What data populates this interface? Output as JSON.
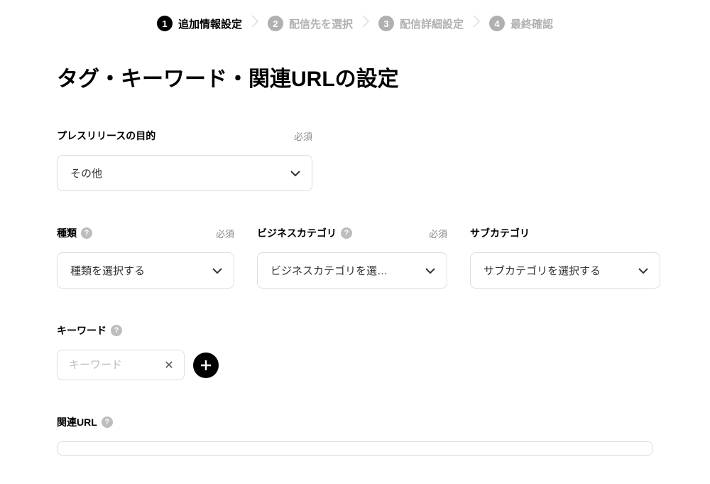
{
  "stepper": {
    "steps": [
      {
        "num": "1",
        "label": "追加情報設定",
        "active": true
      },
      {
        "num": "2",
        "label": "配信先を選択",
        "active": false
      },
      {
        "num": "3",
        "label": "配信詳細設定",
        "active": false
      },
      {
        "num": "4",
        "label": "最終確認",
        "active": false
      }
    ]
  },
  "page": {
    "title": "タグ・キーワード・関連URLの設定"
  },
  "fields": {
    "purpose": {
      "label": "プレスリリースの目的",
      "required": "必須",
      "value": "その他"
    },
    "type": {
      "label": "種類",
      "required": "必須",
      "value": "種類を選択する"
    },
    "bizcat": {
      "label": "ビジネスカテゴリ",
      "required": "必須",
      "value": "ビジネスカテゴリを選…"
    },
    "subcat": {
      "label": "サブカテゴリ",
      "value": "サブカテゴリを選択する"
    },
    "keyword": {
      "label": "キーワード",
      "placeholder": "キーワード"
    },
    "relatedUrl": {
      "label": "関連URL"
    }
  }
}
